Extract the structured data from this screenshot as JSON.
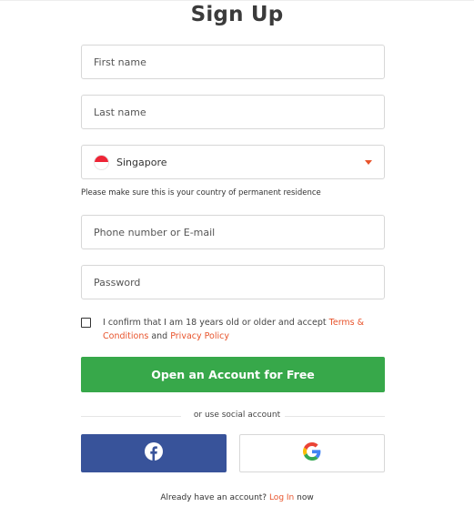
{
  "page": {
    "title": "Sign Up"
  },
  "form": {
    "first_name_placeholder": "First name",
    "last_name_placeholder": "Last name",
    "country_selected": "Singapore",
    "country_hint": "Please make sure this is your country of permanent residence",
    "contact_placeholder": "Phone number or E-mail",
    "password_placeholder": "Password",
    "confirm_text_prefix": "I confirm that I am 18 years old or older and accept ",
    "terms_link": "Terms & Conditions",
    "confirm_text_and": " and ",
    "privacy_link": "Privacy Policy",
    "submit_label": "Open an Account for Free"
  },
  "social": {
    "divider_text": "or use social account",
    "facebook_icon": "facebook-icon",
    "google_icon": "google-icon"
  },
  "footer": {
    "prefix": "Already have an account? ",
    "login_link": "Log In",
    "suffix": " now"
  },
  "colors": {
    "accent": "#e8542c",
    "primary_button": "#37a84a",
    "facebook": "#38539a"
  }
}
